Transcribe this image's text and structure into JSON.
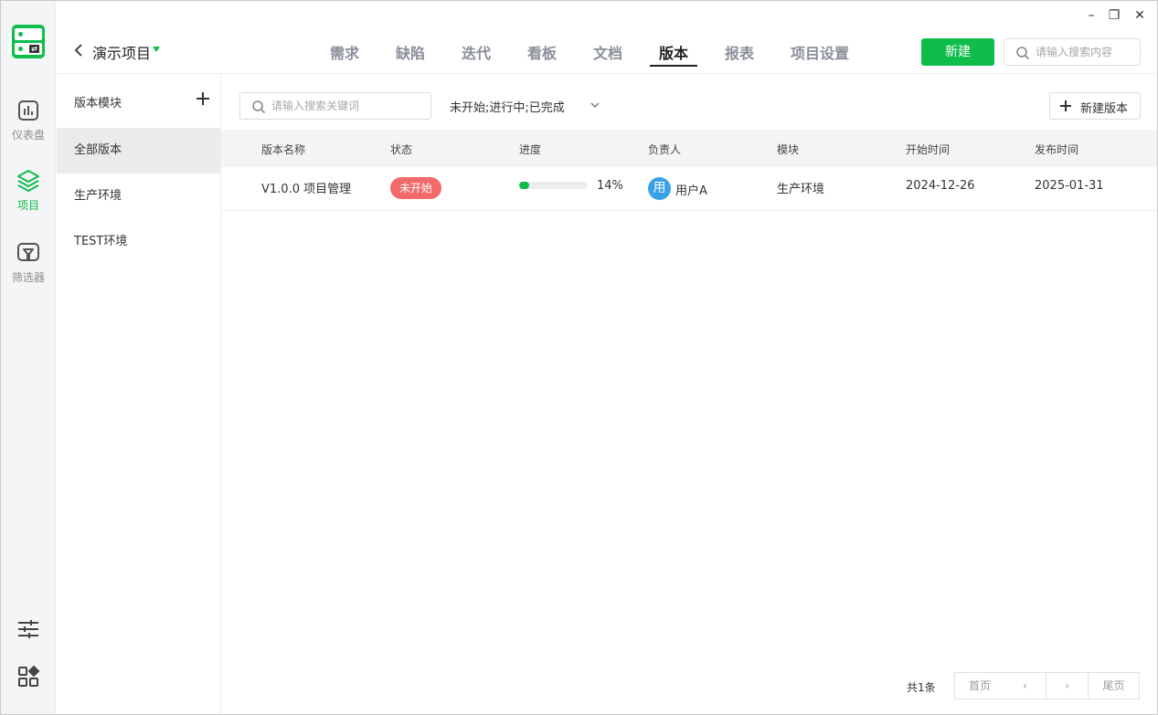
{
  "window": {
    "min": "–",
    "max": "❐",
    "close": "✕"
  },
  "rail": {
    "items": [
      {
        "label": "仪表盘",
        "icon": "dashboard-icon"
      },
      {
        "label": "项目",
        "icon": "layers-icon",
        "active": true
      },
      {
        "label": "筛选器",
        "icon": "filter-icon"
      }
    ],
    "bottom_icons": [
      "settings-sliders-icon",
      "apps-grid-icon"
    ]
  },
  "header": {
    "project_title": "演示项目",
    "tabs": [
      {
        "label": "需求"
      },
      {
        "label": "缺陷"
      },
      {
        "label": "迭代"
      },
      {
        "label": "看板"
      },
      {
        "label": "文档"
      },
      {
        "label": "版本",
        "active": true
      },
      {
        "label": "报表"
      },
      {
        "label": "项目设置"
      }
    ],
    "new_button": "新建",
    "search_placeholder": "请输入搜索内容"
  },
  "modules": {
    "title": "版本模块",
    "items": [
      {
        "label": "全部版本",
        "active": true
      },
      {
        "label": "生产环境"
      },
      {
        "label": "TEST环境"
      }
    ]
  },
  "toolbar": {
    "keyword_placeholder": "请输入搜索关键词",
    "status_filter": "未开始;进行中;已完成",
    "new_version_button": "新建版本"
  },
  "table": {
    "columns": [
      "版本名称",
      "状态",
      "进度",
      "负责人",
      "模块",
      "开始时间",
      "发布时间"
    ],
    "rows": [
      {
        "name": "V1.0.0 项目管理",
        "status": "未开始",
        "progress_pct": "14%",
        "progress": 0.14,
        "owner_avatar": "用",
        "owner": "用户A",
        "module": "生产环境",
        "start": "2024-12-26",
        "release": "2025-01-31"
      }
    ]
  },
  "pagination": {
    "total": "共1条",
    "first": "首页",
    "prev": "‹",
    "next": "›",
    "last": "尾页"
  },
  "colors": {
    "brand": "#0fbd4b",
    "status_not_started": "#f26a6a",
    "avatar": "#3aa0e8"
  }
}
